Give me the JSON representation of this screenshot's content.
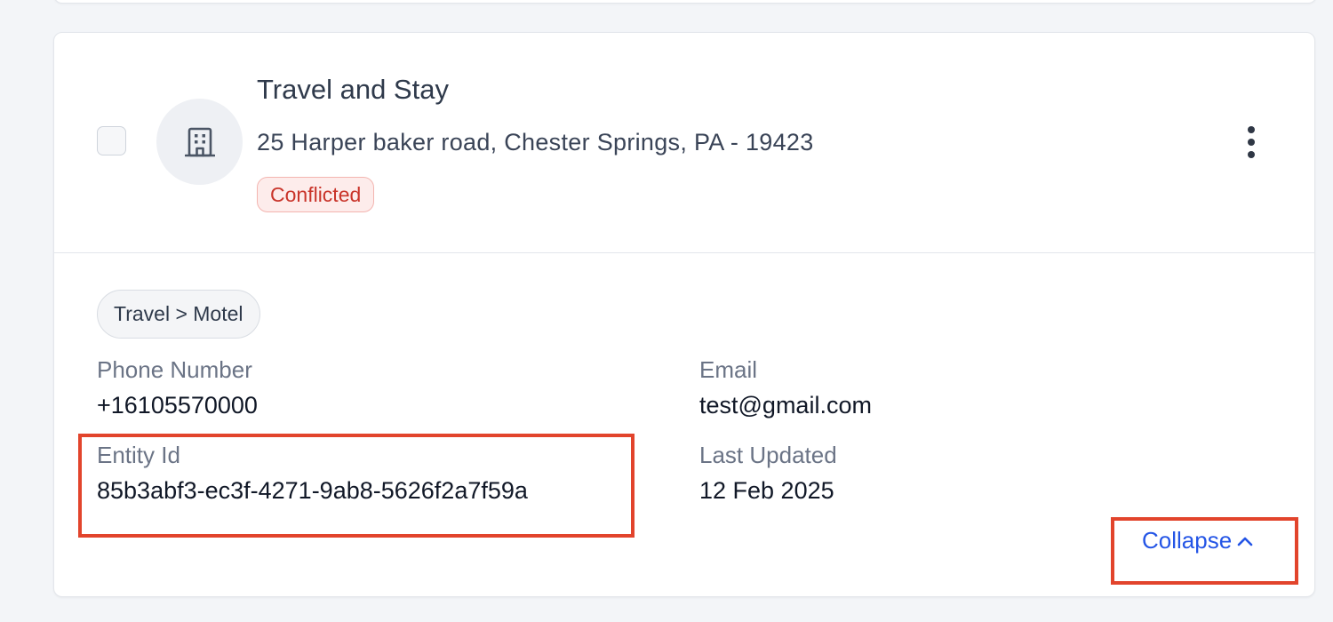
{
  "card": {
    "title": "Travel and Stay",
    "address": "25 Harper baker road, Chester Springs, PA - 19423",
    "status": "Conflicted",
    "category": "Travel > Motel",
    "icon": "building-icon"
  },
  "details": {
    "phone_label": "Phone Number",
    "phone_value": "+16105570000",
    "email_label": "Email",
    "email_value": "test@gmail.com",
    "entity_label": "Entity Id",
    "entity_value": "85b3abf3-ec3f-4271-9ab8-5626f2a7f59a",
    "updated_label": "Last Updated",
    "updated_value": "12 Feb 2025"
  },
  "actions": {
    "collapse_label": "Collapse"
  },
  "colors": {
    "accent": "#2455e6",
    "status_conflicted": "#c9342a",
    "highlight": "#e2442c"
  }
}
